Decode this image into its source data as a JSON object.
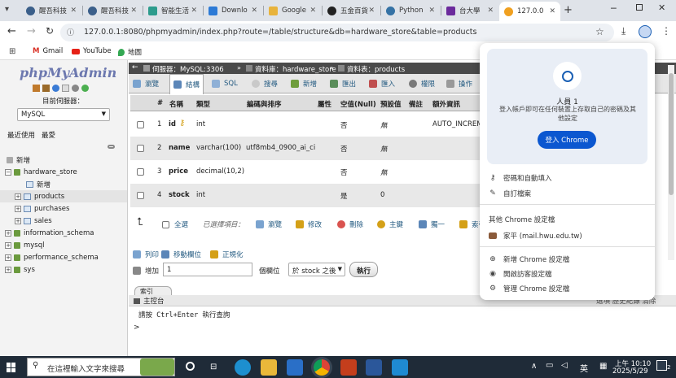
{
  "tabs": [
    {
      "label": "醒吾科技",
      "color": "#3b5f8a"
    },
    {
      "label": "醒吾科技",
      "color": "#3b5f8a"
    },
    {
      "label": "智能生活",
      "color": "#2d9c8d"
    },
    {
      "label": "Downlo",
      "color": "#2c7ad6"
    },
    {
      "label": "Google",
      "color": "#e8b33c"
    },
    {
      "label": "五金百貨",
      "color": "#222222"
    },
    {
      "label": "Python",
      "color": "#3572a5"
    },
    {
      "label": "台大學",
      "color": "#6b2a9c"
    },
    {
      "label": "127.0.0",
      "color": "#f0a020"
    }
  ],
  "address": {
    "url": "127.0.0.1:8080/phpmyadmin/index.php?route=/table/structure&db=hardware_store&table=products"
  },
  "bookmarks": [
    {
      "label": "Gmail"
    },
    {
      "label": "YouTube"
    },
    {
      "label": "地圖"
    }
  ],
  "sidebar": {
    "logo": "phpMyAdmin",
    "server_label": "目前伺服器：",
    "server_value": "MySQL",
    "recent": "最近使用",
    "favorites": "最愛",
    "tree": [
      {
        "label": "新增",
        "level": 0,
        "type": "new"
      },
      {
        "label": "hardware_store",
        "level": 0,
        "type": "db",
        "expanded": true
      },
      {
        "label": "新增",
        "level": 1,
        "type": "new"
      },
      {
        "label": "products",
        "level": 1,
        "type": "table",
        "selected": true
      },
      {
        "label": "purchases",
        "level": 1,
        "type": "table"
      },
      {
        "label": "sales",
        "level": 1,
        "type": "table"
      },
      {
        "label": "information_schema",
        "level": 0,
        "type": "db"
      },
      {
        "label": "mysql",
        "level": 0,
        "type": "db"
      },
      {
        "label": "performance_schema",
        "level": 0,
        "type": "db"
      },
      {
        "label": "sys",
        "level": 0,
        "type": "db"
      }
    ]
  },
  "breadcrumb": {
    "server": "伺服器：MySQL:3306",
    "database": "資料庫：hardware_store",
    "table": "資料表：products"
  },
  "page_tabs": [
    {
      "label": "瀏覽"
    },
    {
      "label": "結構",
      "active": true
    },
    {
      "label": "SQL"
    },
    {
      "label": "搜尋"
    },
    {
      "label": "新增"
    },
    {
      "label": "匯出"
    },
    {
      "label": "匯入"
    },
    {
      "label": "權限"
    },
    {
      "label": "操作"
    }
  ],
  "columns": {
    "headers": [
      "#",
      "名稱",
      "類型",
      "編碼與排序",
      "屬性",
      "空值(Null)",
      "預設值",
      "備註",
      "額外資訊"
    ]
  },
  "rows": [
    {
      "num": "1",
      "name": "id",
      "type": "int",
      "collation": "",
      "attr": "",
      "null": "否",
      "default": "無",
      "extra": "AUTO_INCREMENT",
      "key": true
    },
    {
      "num": "2",
      "name": "name",
      "type": "varchar(100)",
      "collation": "utf8mb4_0900_ai_ci",
      "attr": "",
      "null": "否",
      "default": "無",
      "extra": ""
    },
    {
      "num": "3",
      "name": "price",
      "type": "decimal(10,2)",
      "collation": "",
      "attr": "",
      "null": "否",
      "default": "無",
      "extra": ""
    },
    {
      "num": "4",
      "name": "stock",
      "type": "int",
      "collation": "",
      "attr": "",
      "null": "是",
      "default": "0",
      "extra": ""
    }
  ],
  "bulk": {
    "select_all": "全選",
    "selected": "已選擇項目：",
    "browse": "瀏覽",
    "edit": "修改",
    "delete": "刪除",
    "primary": "主鍵",
    "unique": "獨一",
    "index": "索引"
  },
  "footer_actions": {
    "print": "列印",
    "move": "移動欄位",
    "normalize": "正規化",
    "add": "增加",
    "add_value": "1",
    "column_word": "個欄位",
    "position": "於 stock 之後",
    "go": "執行",
    "index_tab": "索引"
  },
  "console": {
    "title": "主控台",
    "hint": "請按 Ctrl+Enter 執行查詢",
    "prompt": ">",
    "right_text": "選項 歷史紀錄 清除"
  },
  "profile_popup": {
    "name": "人員 1",
    "desc": "登入帳戶即可在任何裝置上存取自己的密碼及其他設定",
    "signin": "登入 Chrome",
    "items": [
      "密碼和自動填入",
      "自訂檔案"
    ],
    "other_profiles": "其他 Chrome 設定檔",
    "other_profile": "家平 (mail.hwu.edu.tw)",
    "bottom_items": [
      "新增 Chrome 設定檔",
      "開啟訪客設定檔",
      "管理 Chrome 設定檔"
    ]
  },
  "taskbar": {
    "search": "在這裡輸入文字來搜尋",
    "time": "上午 10:10",
    "date": "2025/5/29",
    "ime": "英",
    "notif": "2"
  }
}
